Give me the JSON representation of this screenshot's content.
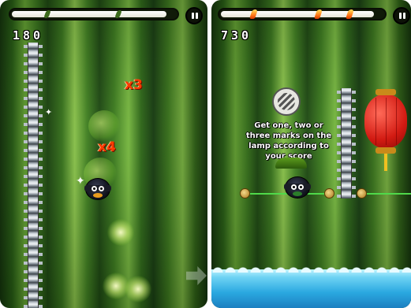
{
  "screens": {
    "left": {
      "score": "180",
      "multipliers": [
        "x3",
        "x4"
      ],
      "pause_icon": "pause-icon"
    },
    "right": {
      "score": "730",
      "hint_text": "Get one, two or three marks on the lamp according to your score",
      "pause_icon": "pause-icon"
    }
  },
  "colors": {
    "bamboo_green": "#3f821e",
    "multiplier": "#ff3b00",
    "lantern": "#d21a12",
    "water": "#2aa8e0",
    "rope": "#4fd94a"
  },
  "icons": {
    "spike_chain": "spike-chain-icon",
    "ninja": "ninja-character-icon",
    "arrow": "next-arrow-icon",
    "lantern": "paper-lantern-icon",
    "hint": "striped-ball-icon"
  }
}
